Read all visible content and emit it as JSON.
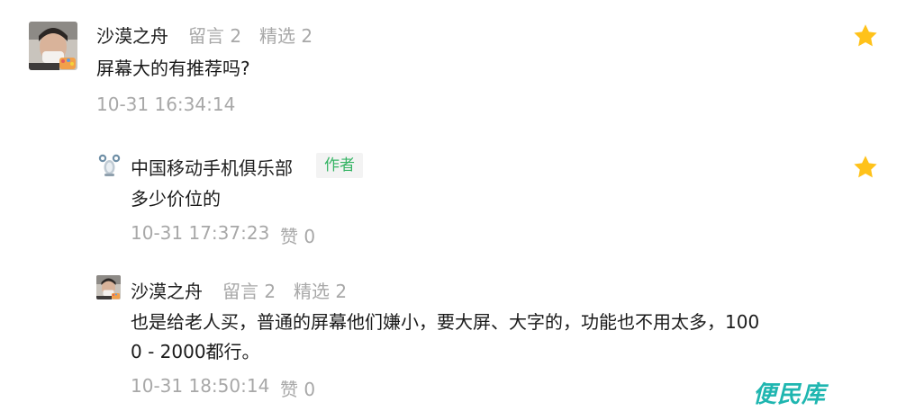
{
  "comment": {
    "user_name": "沙漠之舟",
    "messages_label": "留言 2",
    "featured_label": "精选 2",
    "text": "屏幕大的有推荐吗?",
    "time": "10-31 16:34:14"
  },
  "reply_author": {
    "user_name": "中国移动手机俱乐部",
    "badge": "作者",
    "text": "多少价位的",
    "time": "10-31 17:37:23",
    "likes_label": "赞 0"
  },
  "reply_user": {
    "user_name": "沙漠之舟",
    "messages_label": "留言 2",
    "featured_label": "精选 2",
    "text_line1": "也是给老人买，普通的屏幕他们嫌小，要大屏、大字的，功能也不用太多，100",
    "text_line2": "0 - 2000都行。",
    "time": "10-31 18:50:14",
    "likes_label": "赞 0"
  },
  "watermark": "便民库",
  "colors": {
    "star": "#ffc21a",
    "author_badge_text": "#35b464",
    "meta_gray": "#a8a8a8",
    "watermark": "#1fb6b0"
  },
  "icons": {
    "favorite": "star-icon",
    "author_avatar": "robot-mascot-icon"
  }
}
